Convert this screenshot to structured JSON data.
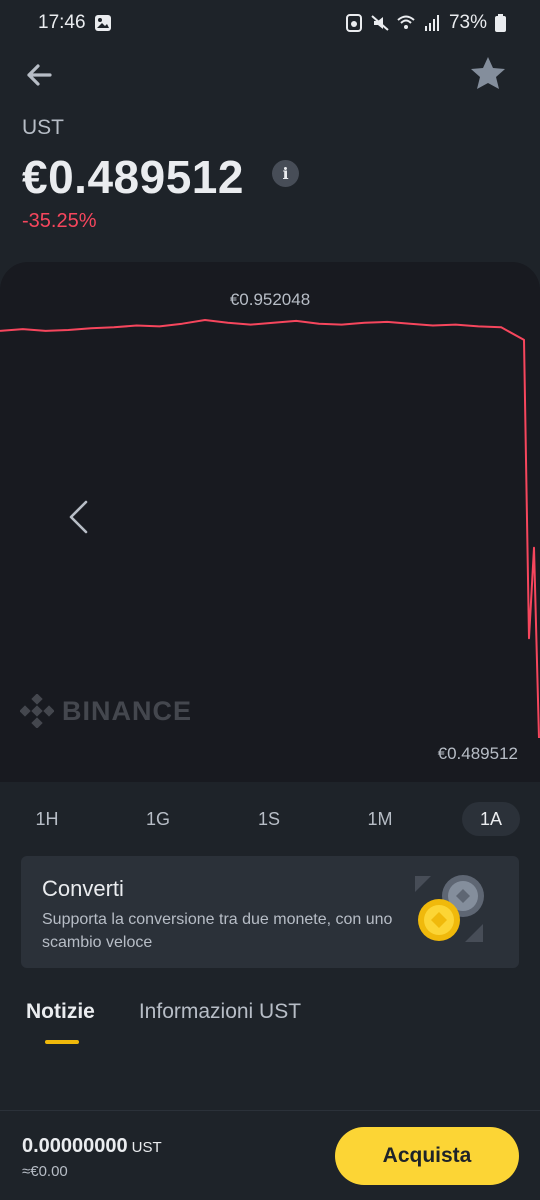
{
  "status_bar": {
    "time": "17:46",
    "battery": "73%"
  },
  "header": {
    "back_icon": "arrow-left-icon",
    "favorite_icon": "star-icon"
  },
  "asset": {
    "symbol": "UST",
    "price": "€0.489512",
    "change": "-35.25%",
    "change_color": "#f6465d"
  },
  "chart": {
    "high_label": "€0.952048",
    "low_label": "€0.489512",
    "watermark": "BINANCE",
    "line_color": "#f6465d"
  },
  "chart_data": {
    "type": "line",
    "series": [
      {
        "values": [
          0.94,
          0.942,
          0.94,
          0.941,
          0.943,
          0.944,
          0.946,
          0.945,
          0.948,
          0.952,
          0.949,
          0.947,
          0.949,
          0.951,
          0.948,
          0.947,
          0.949,
          0.95,
          0.948,
          0.946,
          0.947,
          0.945,
          0.944,
          0.93,
          0.6,
          0.7,
          0.489512
        ]
      }
    ],
    "ylim": [
      0.489512,
      0.952048
    ]
  },
  "periods": [
    {
      "label": "1H",
      "active": false
    },
    {
      "label": "1G",
      "active": false
    },
    {
      "label": "1S",
      "active": false
    },
    {
      "label": "1M",
      "active": false
    },
    {
      "label": "1A",
      "active": true
    }
  ],
  "convert_card": {
    "title": "Converti",
    "description": "Supporta la conversione tra due monete, con uno scambio veloce"
  },
  "tabs": [
    {
      "label": "Notizie",
      "active": true
    },
    {
      "label": "Informazioni UST",
      "active": false
    }
  ],
  "bottom": {
    "balance": "0.00000000",
    "balance_unit": "UST",
    "balance_fiat": "≈€0.00",
    "buy_label": "Acquista",
    "accent": "#fcd535"
  }
}
